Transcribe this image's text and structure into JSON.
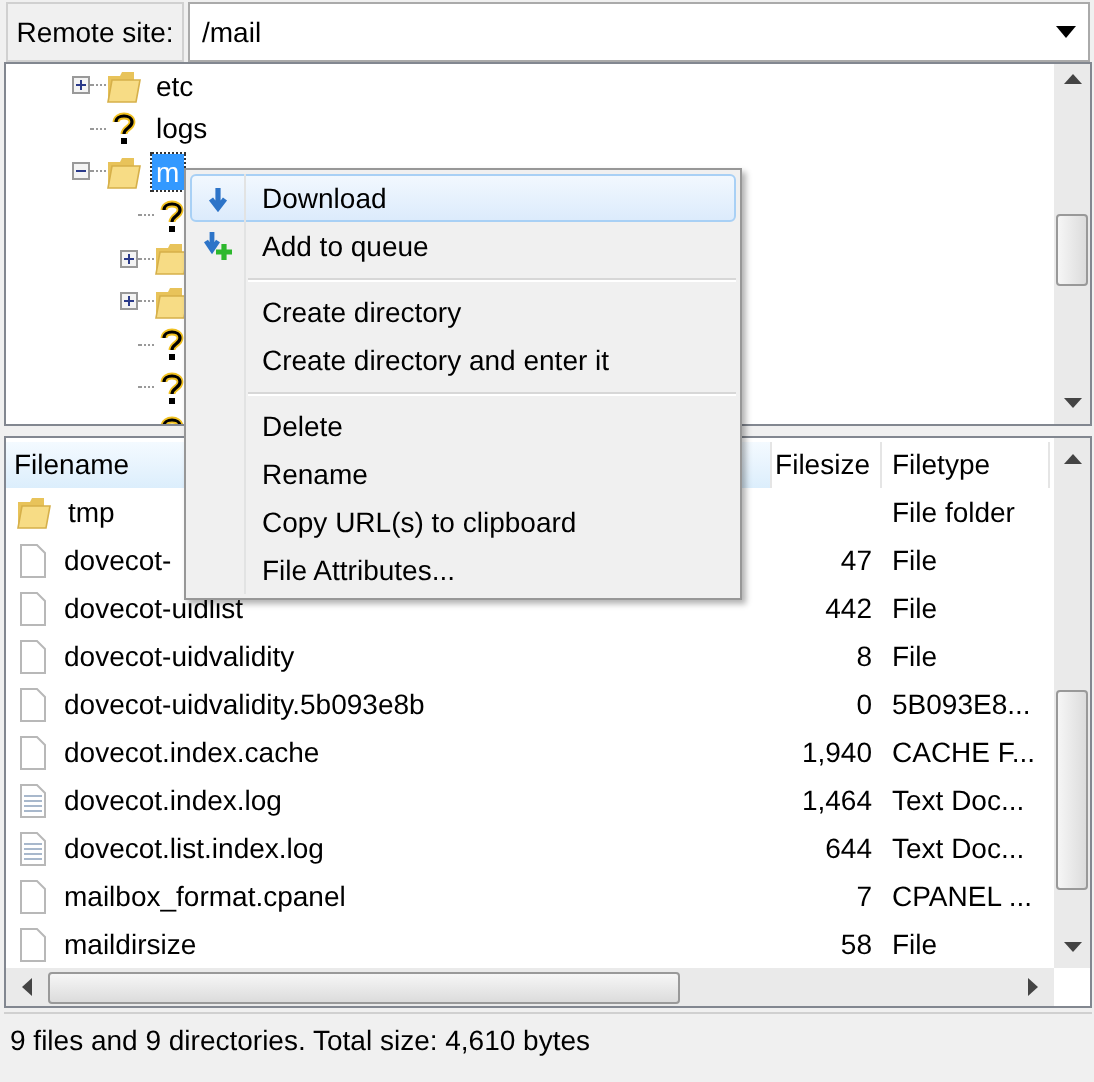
{
  "remote_site": {
    "label": "Remote site:",
    "path": "/mail"
  },
  "tree": [
    {
      "kind": "folder",
      "label": "etc",
      "expanded": false,
      "selected": false
    },
    {
      "kind": "unknown",
      "label": "logs",
      "selected": false
    },
    {
      "kind": "folder",
      "label": "m",
      "expanded": true,
      "selected": true,
      "children": [
        {
          "kind": "unknown"
        },
        {
          "kind": "folder",
          "expanded": false
        },
        {
          "kind": "folder",
          "expanded": false
        },
        {
          "kind": "unknown"
        },
        {
          "kind": "unknown"
        },
        {
          "kind": "unknown"
        }
      ]
    }
  ],
  "context_menu": [
    {
      "kind": "download",
      "label": "Download",
      "selected": true
    },
    {
      "kind": "queue",
      "label": "Add to queue",
      "selected": false
    },
    {
      "kind": "separator"
    },
    {
      "kind": "item",
      "label": "Create directory",
      "selected": false
    },
    {
      "kind": "item",
      "label": "Create directory and enter it",
      "selected": false
    },
    {
      "kind": "separator"
    },
    {
      "kind": "item",
      "label": "Delete",
      "selected": false
    },
    {
      "kind": "item",
      "label": "Rename",
      "selected": false
    },
    {
      "kind": "item",
      "label": "Copy URL(s) to clipboard",
      "selected": false
    },
    {
      "kind": "item",
      "label": "File Attributes...",
      "selected": false
    }
  ],
  "file_list": {
    "columns": [
      {
        "label": "Filename",
        "selected": true
      },
      {
        "label": "Filesize",
        "selected": false
      },
      {
        "label": "Filetype",
        "selected": false
      }
    ],
    "rows": [
      {
        "kind": "folder",
        "name": "tmp",
        "type": "File folder"
      },
      {
        "kind": "file",
        "name": "dovecot-",
        "size": "47",
        "type": "File"
      },
      {
        "kind": "file",
        "name": "dovecot-uidlist",
        "size": "442",
        "type": "File"
      },
      {
        "kind": "file",
        "name": "dovecot-uidvalidity",
        "size": "8",
        "type": "File"
      },
      {
        "kind": "file",
        "name": "dovecot-uidvalidity.5b093e8b",
        "size": "0",
        "type": "5B093E8..."
      },
      {
        "kind": "file",
        "name": "dovecot.index.cache",
        "size": "1,940",
        "type": "CACHE F..."
      },
      {
        "kind": "text",
        "name": "dovecot.index.log",
        "size": "1,464",
        "type": "Text Doc..."
      },
      {
        "kind": "text",
        "name": "dovecot.list.index.log",
        "size": "644",
        "type": "Text Doc..."
      },
      {
        "kind": "file",
        "name": "mailbox_format.cpanel",
        "size": "7",
        "type": "CPANEL ..."
      },
      {
        "kind": "file",
        "name": "maildirsize",
        "size": "58",
        "type": "File"
      }
    ]
  },
  "status_bar": "9 files and 9 directories. Total size: 4,610 bytes"
}
